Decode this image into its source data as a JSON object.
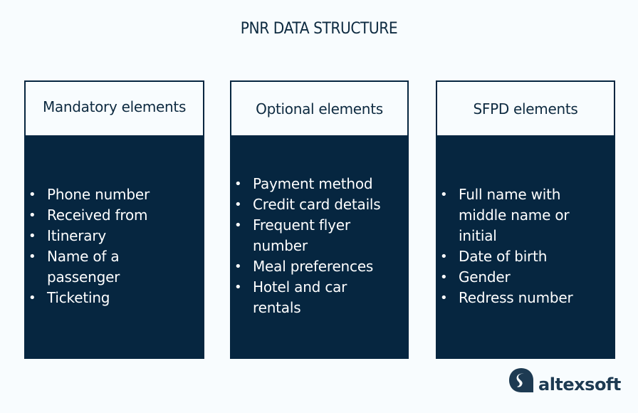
{
  "title": "PNR DATA STRUCTURE",
  "columns": [
    {
      "heading": "Mandatory elements",
      "items": [
        "Phone number",
        "Received from",
        "Itinerary",
        "Name of a passenger",
        "Ticketing"
      ]
    },
    {
      "heading": "Optional elements",
      "items": [
        "Payment method",
        "Credit card details",
        "Frequent flyer number",
        "Meal preferences",
        "Hotel and car rentals"
      ]
    },
    {
      "heading": "SFPD elements",
      "items": [
        "Full name with middle name or initial",
        "Date of birth",
        "Gender",
        "Redress number"
      ]
    }
  ],
  "logo": {
    "icon": "altexsoft-logo-icon",
    "text": "altexsoft"
  },
  "colors": {
    "dark_navy": "#062640",
    "background": "#f8fcfe",
    "text": "#0d2a40"
  }
}
